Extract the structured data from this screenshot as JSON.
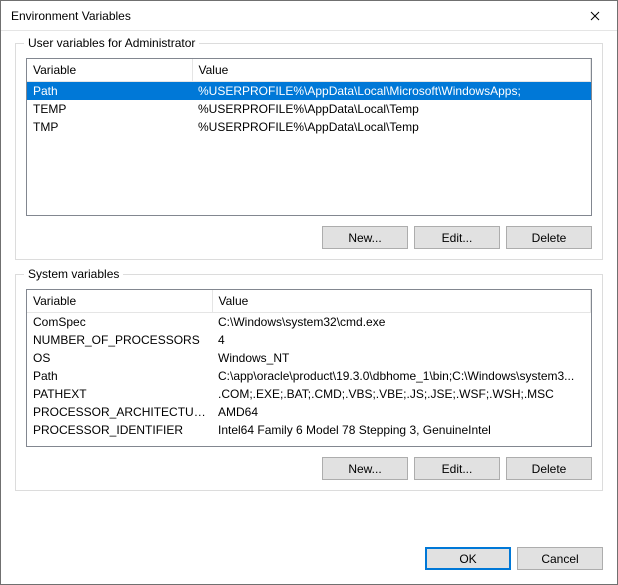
{
  "titlebar": {
    "title": "Environment Variables"
  },
  "user_section": {
    "title": "User variables for Administrator",
    "columns": {
      "variable": "Variable",
      "value": "Value"
    },
    "rows": [
      {
        "variable": "Path",
        "value": "%USERPROFILE%\\AppData\\Local\\Microsoft\\WindowsApps;"
      },
      {
        "variable": "TEMP",
        "value": "%USERPROFILE%\\AppData\\Local\\Temp"
      },
      {
        "variable": "TMP",
        "value": "%USERPROFILE%\\AppData\\Local\\Temp"
      }
    ],
    "buttons": {
      "new": "New...",
      "edit": "Edit...",
      "delete": "Delete"
    }
  },
  "system_section": {
    "title": "System variables",
    "columns": {
      "variable": "Variable",
      "value": "Value"
    },
    "rows": [
      {
        "variable": "ComSpec",
        "value": "C:\\Windows\\system32\\cmd.exe"
      },
      {
        "variable": "NUMBER_OF_PROCESSORS",
        "value": "4"
      },
      {
        "variable": "OS",
        "value": "Windows_NT"
      },
      {
        "variable": "Path",
        "value": "C:\\app\\oracle\\product\\19.3.0\\dbhome_1\\bin;C:\\Windows\\system3..."
      },
      {
        "variable": "PATHEXT",
        "value": ".COM;.EXE;.BAT;.CMD;.VBS;.VBE;.JS;.JSE;.WSF;.WSH;.MSC"
      },
      {
        "variable": "PROCESSOR_ARCHITECTURE",
        "value": "AMD64"
      },
      {
        "variable": "PROCESSOR_IDENTIFIER",
        "value": "Intel64 Family 6 Model 78 Stepping 3, GenuineIntel"
      }
    ],
    "buttons": {
      "new": "New...",
      "edit": "Edit...",
      "delete": "Delete"
    }
  },
  "dialog_buttons": {
    "ok": "OK",
    "cancel": "Cancel"
  }
}
